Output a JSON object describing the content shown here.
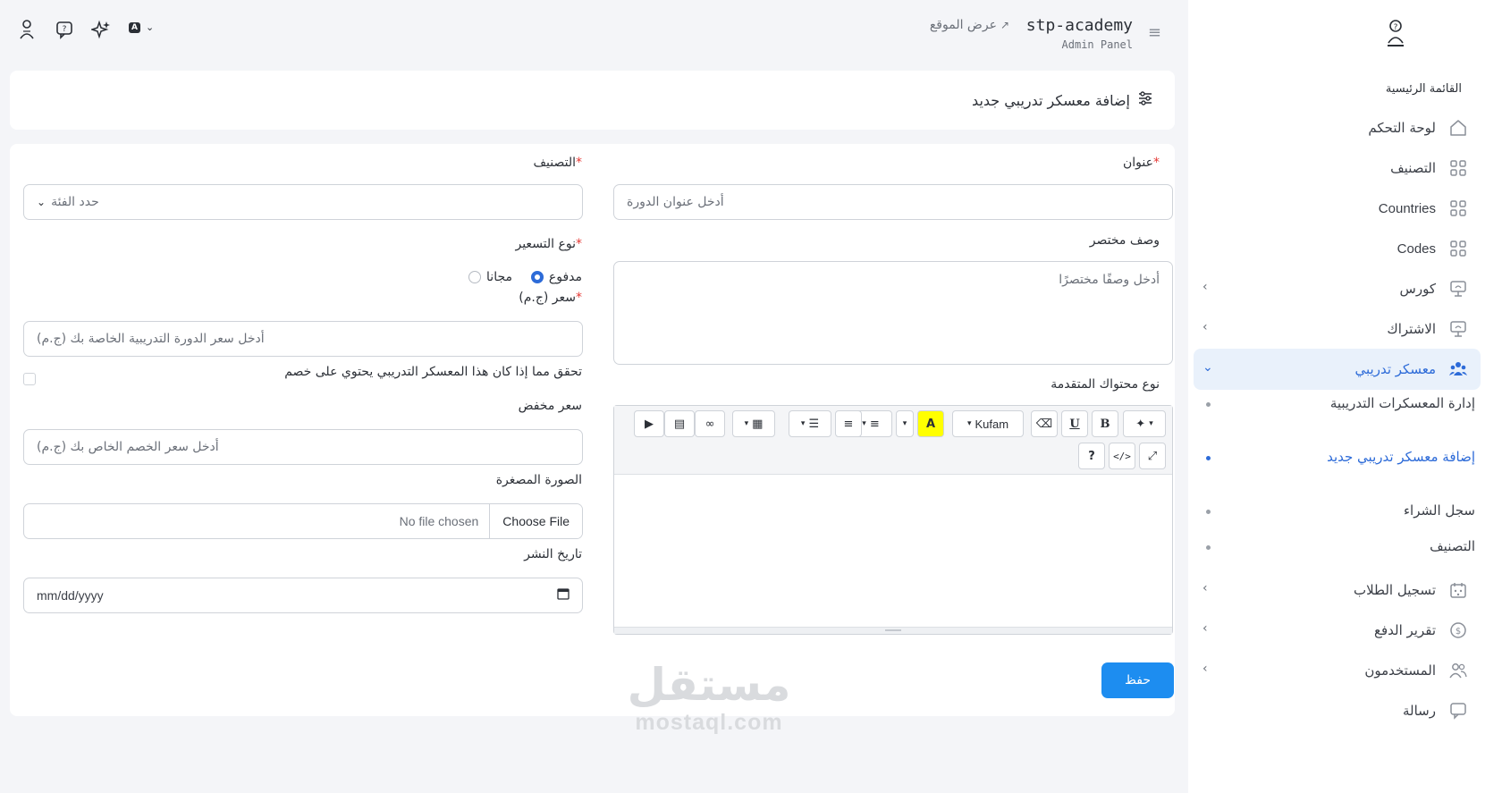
{
  "app": {
    "brand_name": "stp-academy",
    "brand_sub": "Admin Panel",
    "view_site": "عرض الموقع",
    "lang_badge": "A",
    "accent": "#2d6bd8",
    "primary_button_color": "#1d8df0"
  },
  "sidebar": {
    "heading": "القائمة الرئيسية",
    "items": [
      {
        "label": "لوحة التحكم",
        "icon": "home-icon"
      },
      {
        "label": "التصنيف",
        "icon": "grid-icon"
      },
      {
        "label": "Countries",
        "icon": "grid-icon"
      },
      {
        "label": "Codes",
        "icon": "grid-icon"
      },
      {
        "label": "كورس",
        "icon": "presentation-icon"
      },
      {
        "label": "الاشتراك",
        "icon": "presentation-icon"
      },
      {
        "label": "معسكر تدريبي",
        "icon": "users-group-icon"
      },
      {
        "label": "تسجيل الطلاب",
        "icon": "calendar-icon"
      },
      {
        "label": "تقرير الدفع",
        "icon": "dollar-icon"
      },
      {
        "label": "المستخدمون",
        "icon": "users-icon"
      },
      {
        "label": "رسالة",
        "icon": "message-icon"
      }
    ],
    "subitems": [
      {
        "label": "إدارة المعسكرات التدريبية"
      },
      {
        "label": "إضافة معسكر تدريبي جديد"
      },
      {
        "label": "سجل الشراء"
      },
      {
        "label": "التصنيف"
      }
    ]
  },
  "page": {
    "title": "إضافة معسكر تدريبي جديد"
  },
  "form": {
    "title_label": "عنوان",
    "title_placeholder": "أدخل عنوان الدورة",
    "short_desc_label": "وصف مختصر",
    "short_desc_placeholder": "أدخل وصفًا مختصرًا",
    "content_type_label": "نوع محتواك المتقدمة",
    "category_label": "التصنيف",
    "category_value": "حدد الفئة",
    "pricing_label": "نوع التسعير",
    "pricing_paid": "مدفوع",
    "pricing_free": "مجانا",
    "price_label": "سعر (ج.م)",
    "price_placeholder": "أدخل سعر الدورة التدريبية الخاصة بك (ج.م)",
    "discount_check_label": "تحقق مما إذا كان هذا المعسكر التدريبي يحتوي على خصم",
    "discount_price_label": "سعر مخفض",
    "discount_price_placeholder": "أدخل سعر الخصم الخاص بك (ج.م)",
    "thumbnail_label": "الصورة المصغرة",
    "file_choose": "Choose File",
    "file_none": "No file chosen",
    "publish_date_label": "تاريخ النشر",
    "publish_date_placeholder": "mm/dd/yyyy",
    "save": "حفظ",
    "required_mark": "*"
  },
  "editor": {
    "font_name": "Kufam",
    "bold": "B",
    "underline": "U",
    "help": "?",
    "code": "</>"
  },
  "watermark": {
    "ar": "مستقل",
    "en": "mostaql.com"
  }
}
